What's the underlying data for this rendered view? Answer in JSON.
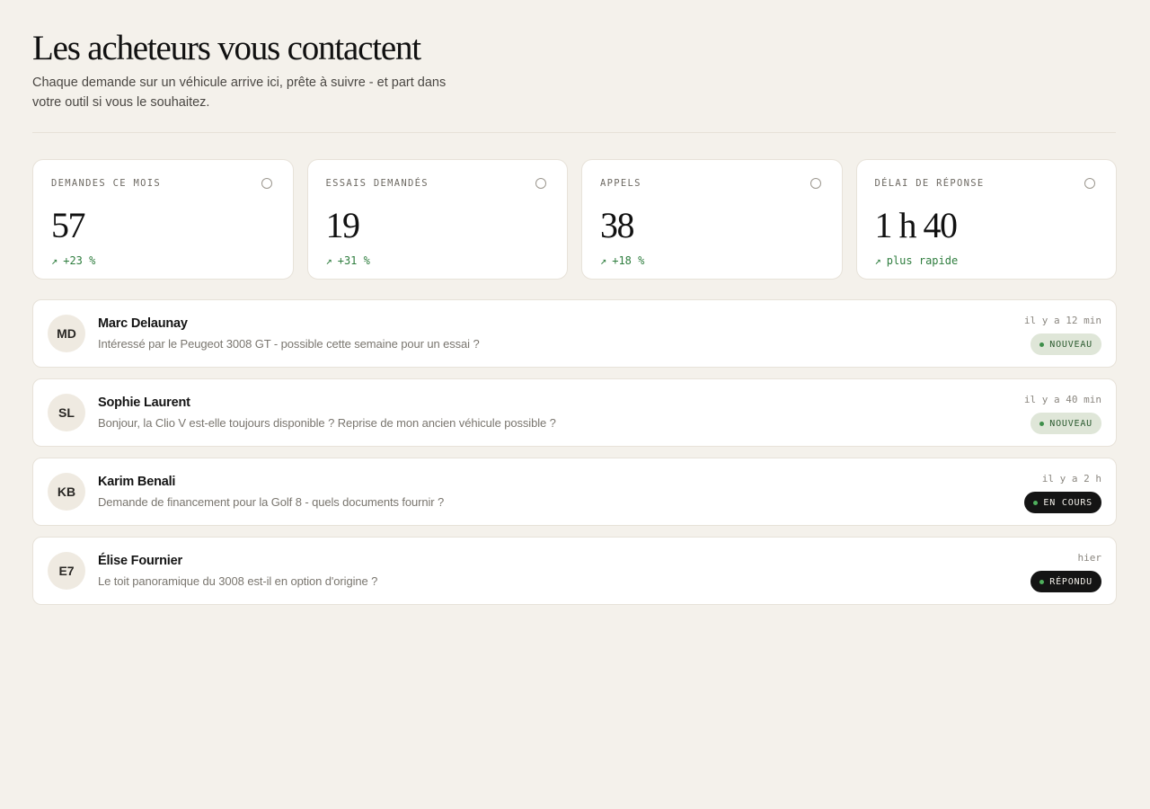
{
  "header": {
    "title": "Les acheteurs vous contactent",
    "subtitle": "Chaque demande sur un véhicule arrive ici, prête à suivre - et part dans votre outil si vous le souhaitez."
  },
  "stats": [
    {
      "label": "DEMANDES CE MOIS",
      "value": "57",
      "trend_arrow": "↗",
      "trend": "+23 %"
    },
    {
      "label": "ESSAIS DEMANDÉS",
      "value": "19",
      "trend_arrow": "↗",
      "trend": "+31 %"
    },
    {
      "label": "APPELS",
      "value": "38",
      "trend_arrow": "↗",
      "trend": "+18 %"
    },
    {
      "label": "DÉLAI DE RÉPONSE",
      "value": "1 h 40",
      "trend_arrow": "↗",
      "trend": "plus rapide"
    }
  ],
  "messages": [
    {
      "initials": "MD",
      "name": "Marc Delaunay",
      "text": "Intéressé par le Peugeot 3008 GT - possible cette semaine pour un essai ?",
      "time": "il y a 12 min",
      "status": "NOUVEAU"
    },
    {
      "initials": "SL",
      "name": "Sophie Laurent",
      "text": "Bonjour, la Clio V est-elle toujours disponible ? Reprise de mon ancien véhicule possible ?",
      "time": "il y a 40 min",
      "status": "NOUVEAU"
    },
    {
      "initials": "KB",
      "name": "Karim Benali",
      "text": "Demande de financement pour la Golf 8 - quels documents fournir ?",
      "time": "il y a 2 h",
      "status": "EN COURS"
    },
    {
      "initials": "E7",
      "name": "Élise Fournier",
      "text": "Le toit panoramique du 3008 est-il en option d'origine ?",
      "time": "hier",
      "status": "RÉPONDU"
    }
  ],
  "colors": {
    "background": "#f4f1eb",
    "trend_green": "#2e7d3e",
    "badge_new_bg": "#dfe6d8",
    "badge_dark_bg": "#141414"
  }
}
